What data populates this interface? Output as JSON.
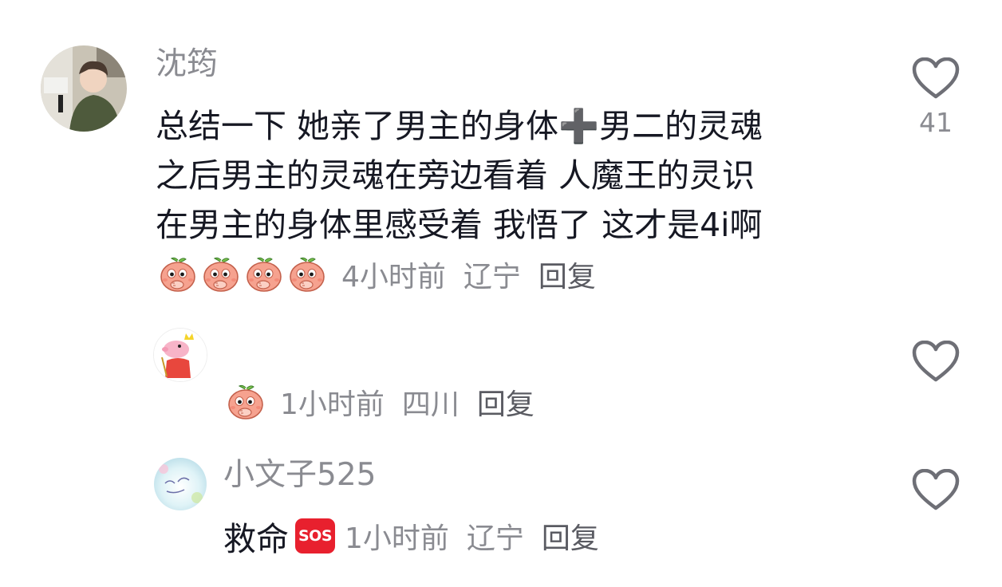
{
  "comments": [
    {
      "username": "沈筠",
      "content_lines": [
        "总结一下 她亲了男主的身体➕男二的灵魂",
        "之后男主的灵魂在旁边看着 人魔王的灵识",
        "在男主的身体里感受着 我悟了 这才是4i啊"
      ],
      "emoji_name": "peach-cover-mouth-emoji",
      "emoji_count": 4,
      "time": "4小时前",
      "location": "辽宁",
      "reply_label": "回复",
      "like_count": "41"
    },
    {
      "username": "",
      "emoji_name": "peach-cover-mouth-emoji",
      "emoji_count": 1,
      "time": "1小时前",
      "location": "四川",
      "reply_label": "回复",
      "like_count": ""
    },
    {
      "username": "小文子525",
      "content_text": "救命",
      "badge_text": "SOS",
      "time": "1小时前",
      "location": "辽宁",
      "reply_label": "回复",
      "like_count": ""
    }
  ],
  "colors": {
    "text_primary": "#161823",
    "text_secondary": "#8a8b91",
    "sos_red": "#e8202e",
    "peach": "#f6a28f",
    "heart_stroke": "#6e6f76"
  },
  "icons": [
    "heart-outline-icon",
    "peach-cover-mouth-emoji",
    "sos-icon",
    "avatar-photo"
  ]
}
